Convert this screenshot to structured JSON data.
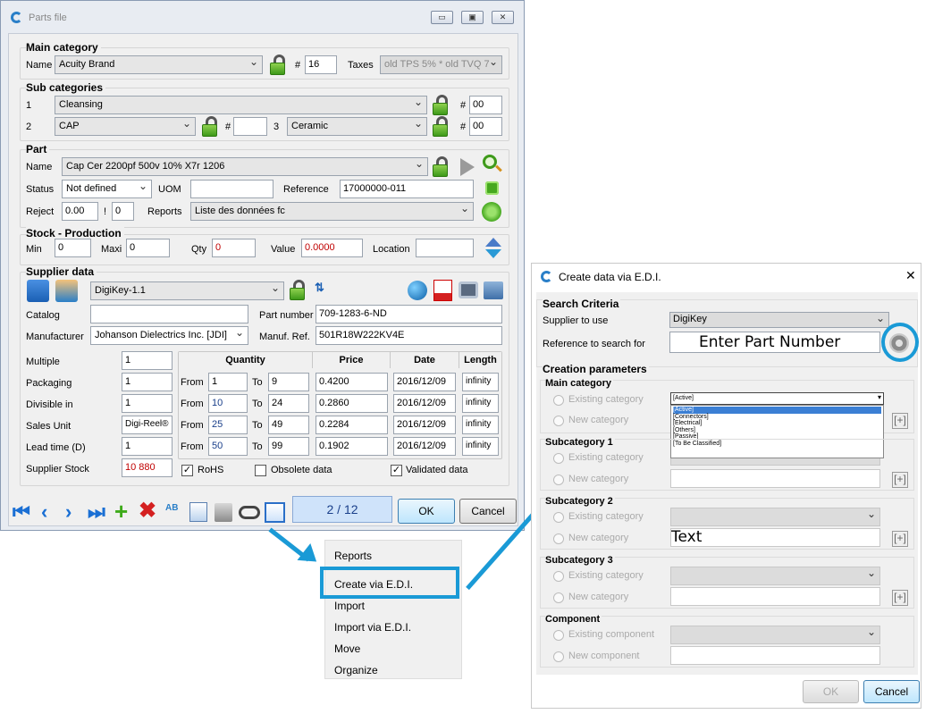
{
  "parts_window": {
    "title": "Parts file",
    "min_btn": "▭",
    "max_btn": "▣",
    "close_btn": "✕",
    "main_category": {
      "title": "Main category",
      "name_label": "Name",
      "name_value": "Acuity Brand",
      "hash_label": "#",
      "hash_value": "16",
      "taxes_label": "Taxes",
      "taxes_value": "old TPS 5% * old TVQ 7"
    },
    "sub_categories": {
      "title": "Sub categories",
      "row1_label": "1",
      "row1_value": "Cleansing",
      "row1_hash_label": "#",
      "row1_hash": "00",
      "row2_label": "2",
      "row2_value": "CAP",
      "row2_hash_label": "#",
      "row2_hash": "",
      "row3_label": "3",
      "row3_value": "Ceramic",
      "row3_hash_label": "#",
      "row3_hash": "00"
    },
    "part": {
      "title": "Part",
      "name_label": "Name",
      "name_value": "Cap Cer 2200pf 500v 10% X7r 1206",
      "status_label": "Status",
      "status_value": "Not defined",
      "uom_label": "UOM",
      "uom_value": "",
      "reference_label": "Reference",
      "reference_value": "17000000-011",
      "reject_label": "Reject",
      "reject_value": "0.00",
      "excl_label": "!",
      "excl_value": "0",
      "reports_label": "Reports",
      "reports_value": "Liste des données fc"
    },
    "stock": {
      "title": "Stock - Production",
      "min_label": "Min",
      "min_value": "0",
      "maxi_label": "Maxi",
      "maxi_value": "0",
      "qty_label": "Qty",
      "qty_value": "0",
      "value_label": "Value",
      "value_value": "0.0000",
      "location_label": "Location",
      "location_value": ""
    },
    "supplier": {
      "title": "Supplier data",
      "supplier_value": "DigiKey-1.1",
      "catalog_label": "Catalog",
      "catalog_value": "",
      "part_number_label": "Part number",
      "part_number_value": "709-1283-6-ND",
      "manufacturer_label": "Manufacturer",
      "manufacturer_value": "Johanson Dielectrics Inc. [JDI]",
      "manuf_ref_label": "Manuf. Ref.",
      "manuf_ref_value": "501R18W222KV4E",
      "multiple_label": "Multiple",
      "multiple_value": "1",
      "packaging_label": "Packaging",
      "packaging_value": "1",
      "divisible_label": "Divisible in",
      "divisible_value": "1",
      "sales_unit_label": "Sales Unit",
      "sales_unit_value": "Digi-Reel®",
      "lead_time_label": "Lead time (D)",
      "lead_time_value": "1",
      "supplier_stock_label": "Supplier Stock",
      "supplier_stock_value": "10 880",
      "table_headers": {
        "quantity": "Quantity",
        "price": "Price",
        "date": "Date",
        "length": "Length"
      },
      "from_label": "From",
      "to_label": "To",
      "rows": [
        {
          "from": "1",
          "to": "9",
          "price": "0.4200",
          "date": "2016/12/09",
          "length": "infinity"
        },
        {
          "from": "10",
          "to": "24",
          "price": "0.2860",
          "date": "2016/12/09",
          "length": "infinity"
        },
        {
          "from": "25",
          "to": "49",
          "price": "0.2284",
          "date": "2016/12/09",
          "length": "infinity"
        },
        {
          "from": "50",
          "to": "99",
          "price": "0.1902",
          "date": "2016/12/09",
          "length": "infinity"
        }
      ],
      "rohs_label": "RoHS",
      "obsolete_label": "Obsolete data",
      "validated_label": "Validated data"
    },
    "counter": "2 / 12",
    "ok_label": "OK",
    "cancel_label": "Cancel"
  },
  "context_menu": {
    "items": [
      "Reports",
      "Create via E.D.I.",
      "Import",
      "Import via E.D.I.",
      "Move",
      "Organize"
    ]
  },
  "edi_window": {
    "title": "Create data via E.D.I.",
    "close_btn": "✕",
    "search_criteria_title": "Search Criteria",
    "supplier_label": "Supplier to use",
    "supplier_value": "DigiKey",
    "reference_label": "Reference to search for",
    "reference_value": "Enter Part Number",
    "creation_title": "Creation parameters",
    "main_category_title": "Main category",
    "existing_category": "Existing category",
    "new_category": "New category",
    "main_selected": "[Active]",
    "main_options": [
      "[Active]",
      "[Connectors]",
      "[Electrical]",
      "[Others]",
      "[Passive]",
      "[To Be Classified]"
    ],
    "sub1_title": "Subcategory 1",
    "sub2_title": "Subcategory 2",
    "sub2_new_value": "Text",
    "sub3_title": "Subcategory 3",
    "component_title": "Component",
    "existing_component": "Existing component",
    "new_component": "New component",
    "plus_label": "[+]",
    "ok_label": "OK",
    "cancel_label": "Cancel"
  },
  "colors": {
    "accent": "#1a9ad6",
    "lock_green": "#3e9a1a",
    "red_value": "#c00000"
  }
}
